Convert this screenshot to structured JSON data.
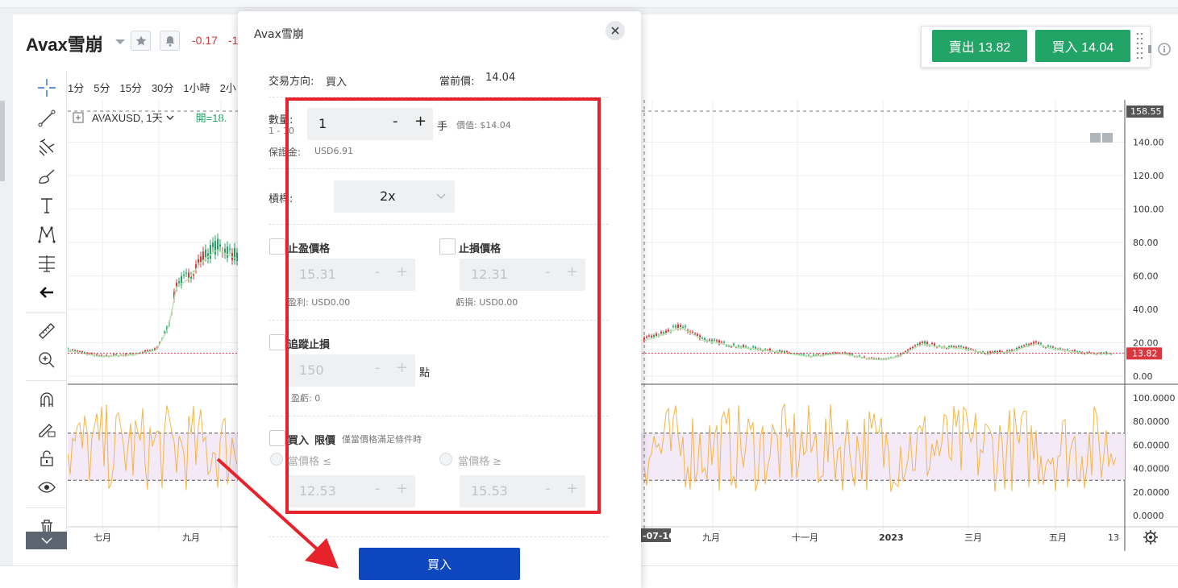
{
  "header": {
    "title": "Avax雪崩",
    "change1": "-0.17",
    "change2": "-1",
    "sell_label": "賣出 13.82",
    "buy_label": "買入 14.04"
  },
  "timeframes": [
    "1分",
    "5分",
    "15分",
    "30分",
    "1小時",
    "2小"
  ],
  "legend": {
    "symbol": "AVAXUSD, 1天",
    "open_label": "開=18."
  },
  "price_axis": {
    "ticks": [
      "158.55",
      "140.00",
      "120.00",
      "100.00",
      "80.00",
      "60.00",
      "40.00",
      "20.00",
      "13.82",
      "0.00"
    ]
  },
  "indicator_axis": {
    "ticks": [
      "100.0000",
      "80.0000",
      "60.0000",
      "40.0000",
      "20.0000",
      "0.0000"
    ]
  },
  "time_axis": {
    "ticks": [
      "七月",
      "九月",
      "-07-16",
      "九月",
      "十一月",
      "2023",
      "三月",
      "五月",
      "13"
    ]
  },
  "chart_data": {
    "type": "line",
    "title": "AVAXUSD, 1天",
    "ylim": [
      0,
      158.55
    ],
    "last_price": 13.82,
    "crosshair_price": 158.55,
    "crosshair_date": "-07-16",
    "rsi_band": [
      30,
      70
    ],
    "rsi_ylim": [
      0,
      100
    ],
    "x": [
      "七月",
      "九月",
      "-07-16",
      "九月",
      "十一月",
      "2023",
      "三月",
      "五月",
      "13"
    ]
  },
  "modal": {
    "title": "Avax雪崩",
    "direction_label": "交易方向:",
    "direction_value": "買入",
    "current_price_label": "當前價:",
    "current_price_value": "14.04",
    "qty_label": "數量:",
    "qty_range": "1 - 10",
    "qty_value": "1",
    "minus": "-",
    "plus": "+",
    "qty_unit": "手",
    "value_label": "價值: $14.04",
    "margin_label": "保證金:",
    "margin_value": "USD6.91",
    "leverage_label": "槓桿:",
    "leverage_value": "2x",
    "tp_label": "止盈價格",
    "tp_value": "15.31",
    "tp_profit": "盈利: USD0.00",
    "sl_label": "止損價格",
    "sl_value": "12.31",
    "sl_loss": "虧損: USD0.00",
    "trail_label": "追蹤止損",
    "trail_value": "150",
    "trail_unit": "點",
    "trail_pl": "盈虧: 0",
    "limit_label_a": "買入",
    "limit_label_b": "限價",
    "limit_hint": "僅當價格滿足條件時",
    "cond_le": "當價格 ≤",
    "cond_ge": "當價格 ≥",
    "le_value": "12.53",
    "ge_value": "15.53",
    "submit_label": "買入"
  },
  "colors": {
    "buy_green": "#21a466",
    "sell_red": "#d9363e",
    "submit_blue": "#0d47c0",
    "highlight_red": "#e8222a",
    "rsi_line": "#f5b547"
  }
}
